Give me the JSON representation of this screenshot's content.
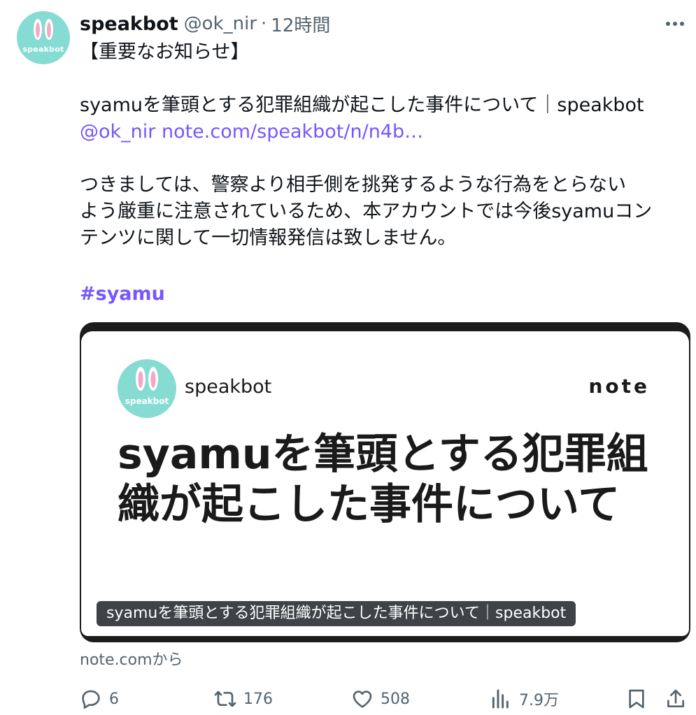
{
  "tweet": {
    "display_name": "speakbot",
    "handle": "@ok_nir",
    "separator": "·",
    "time": "12時間",
    "avatar_text": "speakbot",
    "lines": {
      "heading": "【重要なお知らせ】",
      "title_line": "syamuを筆頭とする犯罪組織が起こした事件について｜speakbot",
      "link_handle": "@ok_nir",
      "link_url": "note.com/speakbot/n/n4b…",
      "para1": "つきましては、警察より相手側を挑発するような行為をとらない",
      "para2": "よう厳重に注意されているため、本アカウントでは今後syamuコン",
      "para3": "テンツに関して一切情報発信は致しません。",
      "hashtag": "#syamu"
    }
  },
  "card": {
    "author": "speakbot",
    "avatar_text": "speakbot",
    "brand": "note",
    "title_line1": "syamuを筆頭とする犯罪組",
    "title_line2": "織が起こした事件について",
    "caption": "syamuを筆頭とする犯罪組織が起こした事件について｜speakbot",
    "source": "note.comから"
  },
  "actions": {
    "replies": "6",
    "retweets": "176",
    "likes": "508",
    "views": "7.9万"
  },
  "colors": {
    "link": "#7856ff",
    "muted": "#536471",
    "avatar_bg": "#86dcd2"
  }
}
